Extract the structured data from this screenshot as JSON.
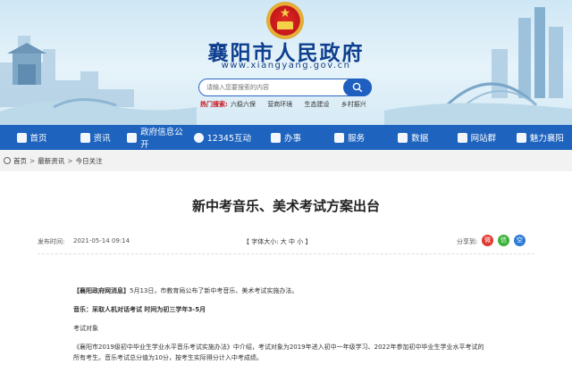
{
  "header": {
    "site_title": "襄阳市人民政府",
    "site_url": "www.xiangyang.gov.cn",
    "search": {
      "placeholder": "请输入您要搜索的内容"
    },
    "hot_search_label": "热门搜索:",
    "hot_search_items": [
      "六稳六保",
      "营商环境",
      "生态建设",
      "乡村振兴"
    ]
  },
  "nav": {
    "items": [
      {
        "label": "首页",
        "icon": "home-icon"
      },
      {
        "label": "资讯",
        "icon": "news-icon"
      },
      {
        "label": "政府信息公开",
        "icon": "info-open-icon"
      },
      {
        "label": "12345互动",
        "icon": "hotline-icon"
      },
      {
        "label": "办事",
        "icon": "service-icon"
      },
      {
        "label": "服务",
        "icon": "grid-icon"
      },
      {
        "label": "数据",
        "icon": "data-icon"
      },
      {
        "label": "网站群",
        "icon": "site-group-icon"
      },
      {
        "label": "魅力襄阳",
        "icon": "charm-icon"
      }
    ]
  },
  "breadcrumb": {
    "items": [
      "首页",
      "最新资讯",
      "今日关注"
    ],
    "separator": ">"
  },
  "article": {
    "title": "新中考音乐、美术考试方案出台",
    "publish_label": "发布时间:",
    "publish_date": "2021-05-14 09:14",
    "font_size_control": "【 字体大小: 大 中 小 】",
    "share_label": "分享到:",
    "paragraphs": {
      "lead_source": "【襄阳政府网消息】",
      "lead_text": "5月13日，市教育局公布了新中考音乐、美术考试实施办法。",
      "music_heading": "音乐：采取人机对话考试 时间为初三学年3-5月",
      "subject_label": "考试对象",
      "body_1": "《襄阳市2019级初中毕业生学业水平音乐考试实施办法》中介绍，考试对象为2019年进入初中一年级学习、2022年参加初中毕业生学业水平考试的",
      "body_2": "所有考生。音乐考试总分值为10分，按考生实际得分计入中考成绩。"
    }
  },
  "colors": {
    "nav_bg": "#1e63be",
    "title_blue": "#0e3f8f",
    "hot_red": "#c8161e"
  }
}
